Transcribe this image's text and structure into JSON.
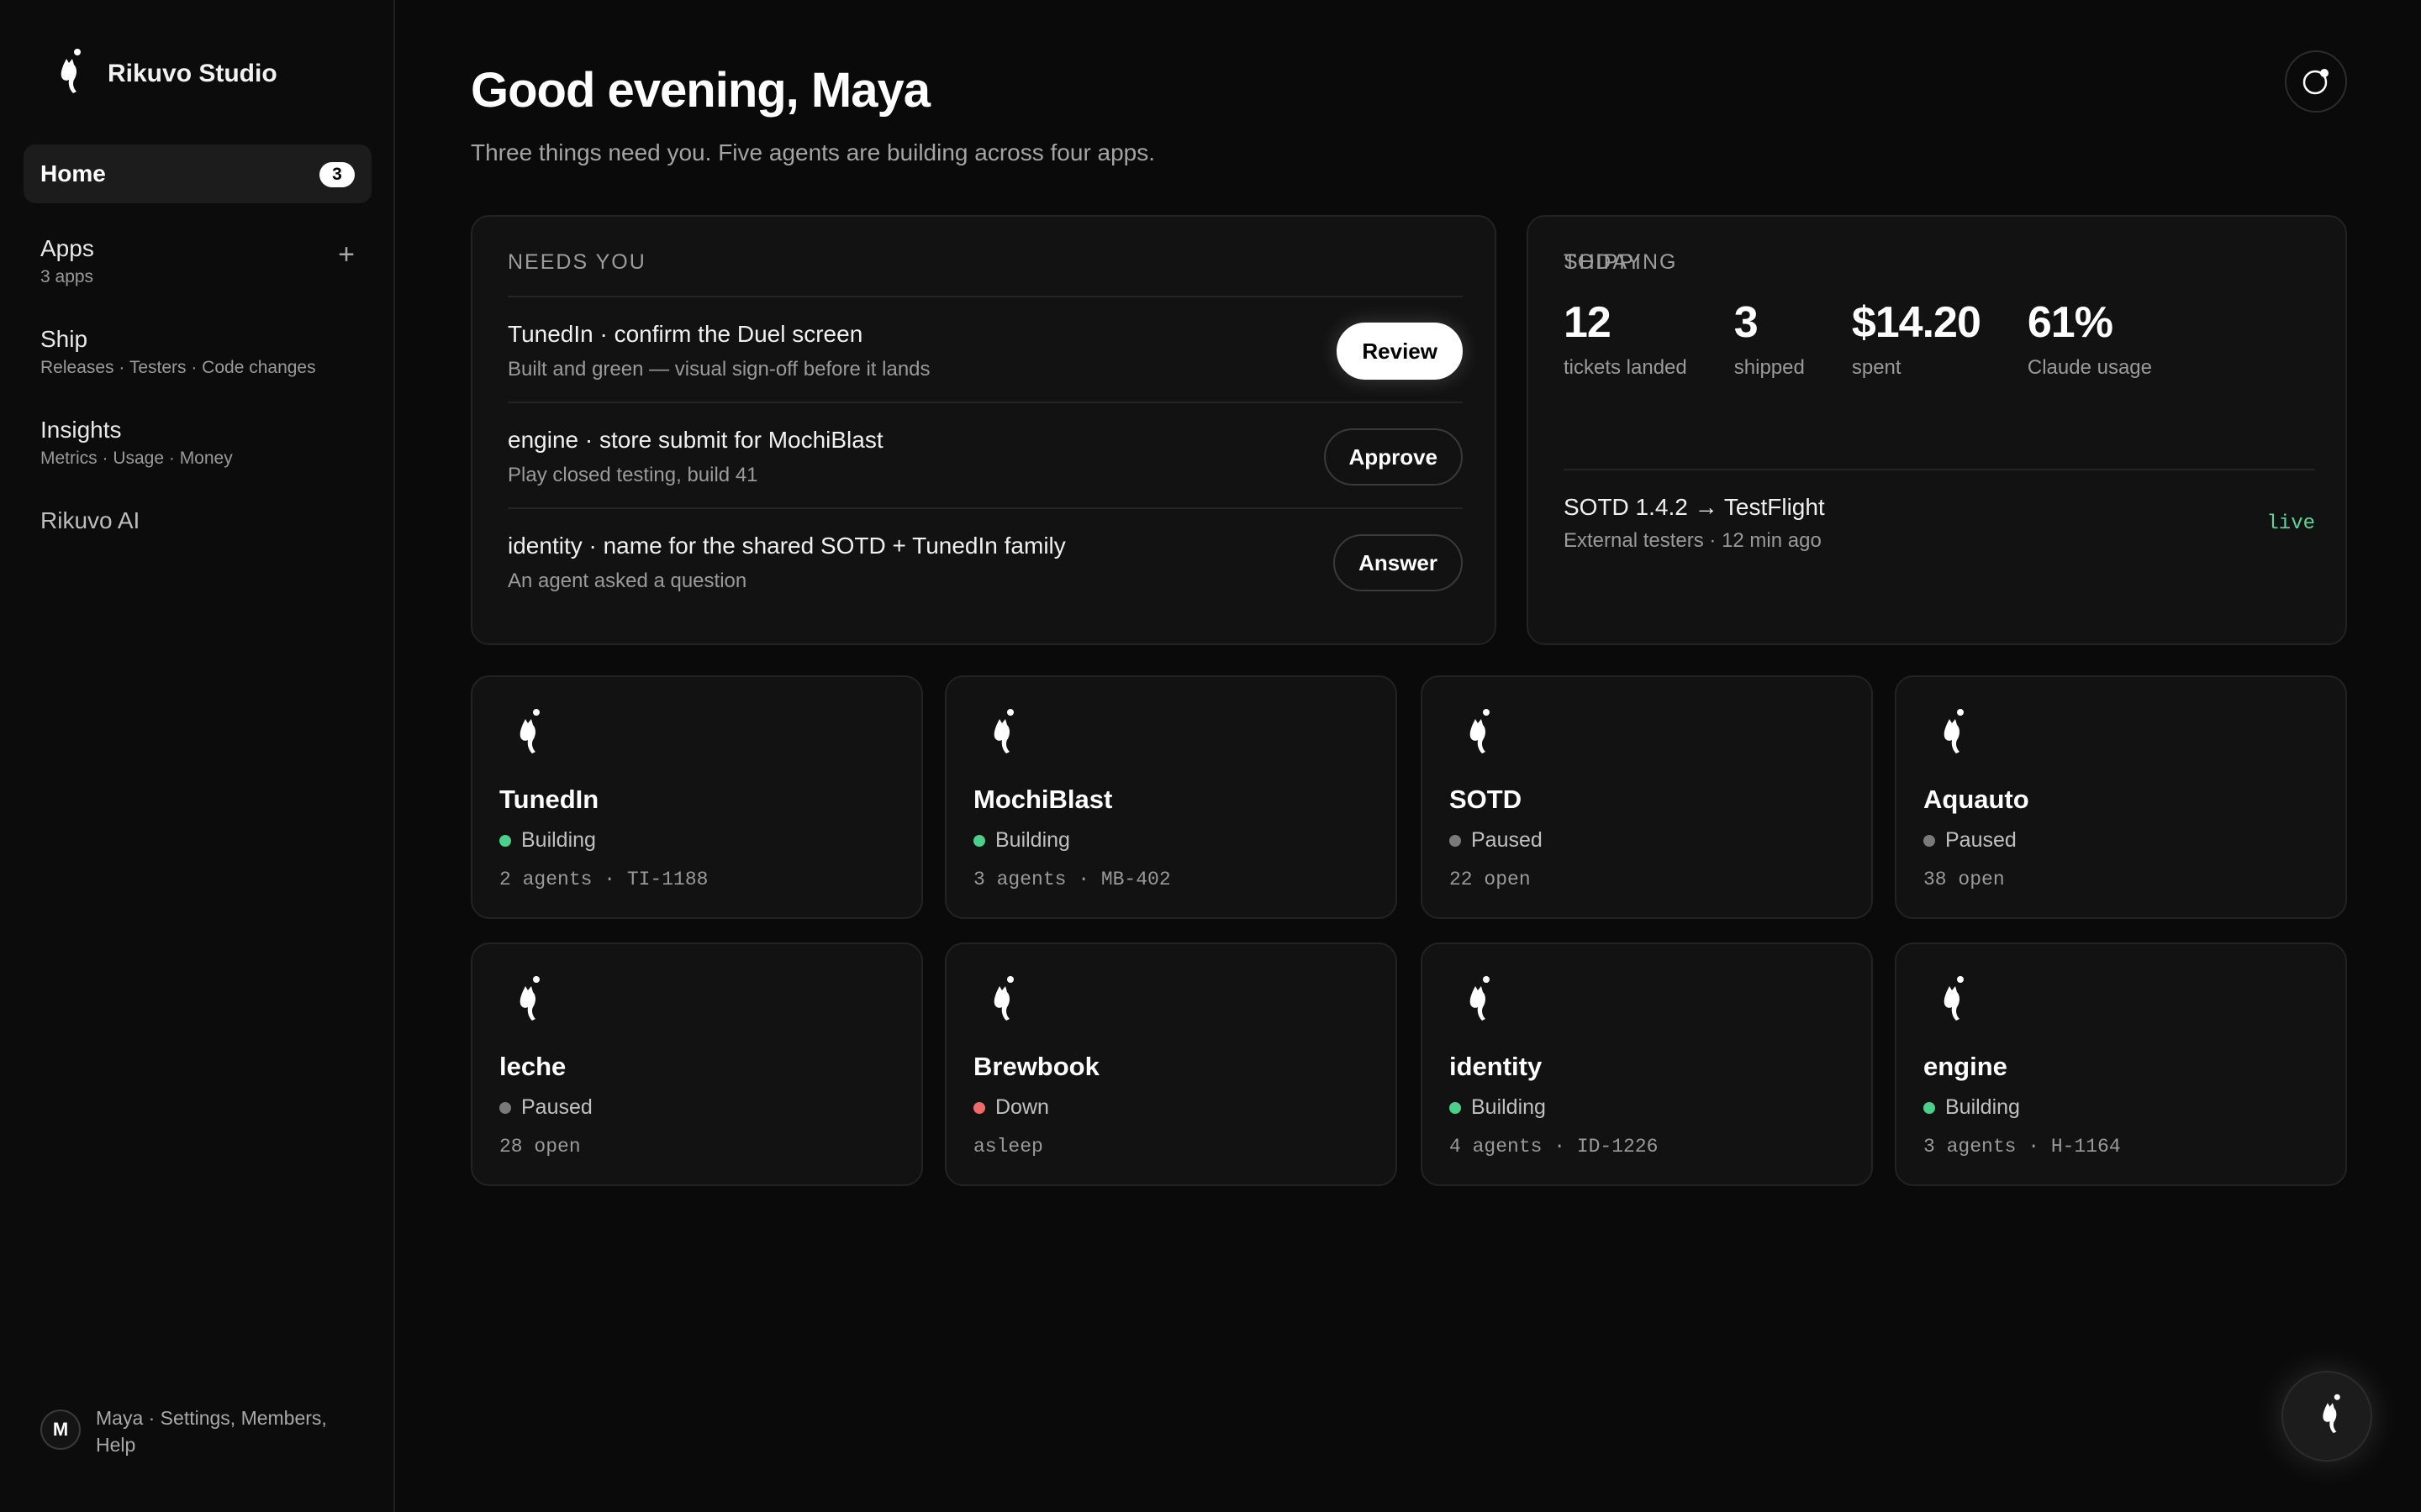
{
  "brand": {
    "name": "Rikuvo Studio",
    "logo_icon": "cat-moon-logo-icon"
  },
  "sidebar": {
    "items": [
      {
        "label": "Home",
        "badge": "3",
        "active": true
      },
      {
        "label": "Apps",
        "sub": "3 apps",
        "action": "+"
      },
      {
        "label": "Ship",
        "sub": "Releases · Testers · Code changes"
      },
      {
        "label": "Insights",
        "sub": "Metrics · Usage · Money"
      },
      {
        "label": "Rikuvo AI"
      }
    ],
    "user": {
      "initial": "M",
      "text": "Maya · Settings, Members, Help"
    }
  },
  "header": {
    "greeting": "Good evening, Maya",
    "subline": "Three things need you. Five agents are building across four apps.",
    "corner_icon": "notification-ring-icon"
  },
  "needs_you": {
    "label": "NEEDS YOU",
    "tasks": [
      {
        "title": "TunedIn · confirm the Duel screen",
        "sub": "Built and green — visual sign-off before it lands",
        "action": "Review"
      },
      {
        "title": "engine · store submit for MochiBlast",
        "sub": "Play closed testing, build 41",
        "action": "Approve"
      },
      {
        "title": "identity · name for the shared SOTD + TunedIn family",
        "sub": "An agent asked a question",
        "action": "Answer"
      }
    ]
  },
  "today": {
    "label": "TODAY",
    "stats": [
      {
        "value": "12",
        "label": "tickets landed"
      },
      {
        "value": "3",
        "label": "shipped"
      },
      {
        "value": "$14.20",
        "label": "spent"
      },
      {
        "value": "61%",
        "label": "Claude usage"
      }
    ],
    "shipping_label": "SHIPPING",
    "shipping": {
      "title": "SOTD 1.4.2 → TestFlight",
      "sub": "External testers · 12 min ago",
      "status": "live"
    }
  },
  "apps": [
    {
      "name": "TunedIn",
      "status": "Building",
      "status_color": "#4ccf8a",
      "meta": "2 agents · TI-1188"
    },
    {
      "name": "MochiBlast",
      "status": "Building",
      "status_color": "#4ccf8a",
      "meta": "3 agents · MB-402"
    },
    {
      "name": "SOTD",
      "status": "Paused",
      "status_color": "#7a7a7a",
      "meta": "22 open"
    },
    {
      "name": "Aquauto",
      "status": "Paused",
      "status_color": "#7a7a7a",
      "meta": "38 open"
    },
    {
      "name": "leche",
      "status": "Paused",
      "status_color": "#7a7a7a",
      "meta": "28 open"
    },
    {
      "name": "Brewbook",
      "status": "Down",
      "status_color": "#ef6b6b",
      "meta": "asleep"
    },
    {
      "name": "identity",
      "status": "Building",
      "status_color": "#4ccf8a",
      "meta": "4 agents · ID-1226"
    },
    {
      "name": "engine",
      "status": "Building",
      "status_color": "#4ccf8a",
      "meta": "3 agents · H-1164"
    }
  ],
  "fab": {
    "icon": "rikuvo-ai-assistant-icon"
  }
}
